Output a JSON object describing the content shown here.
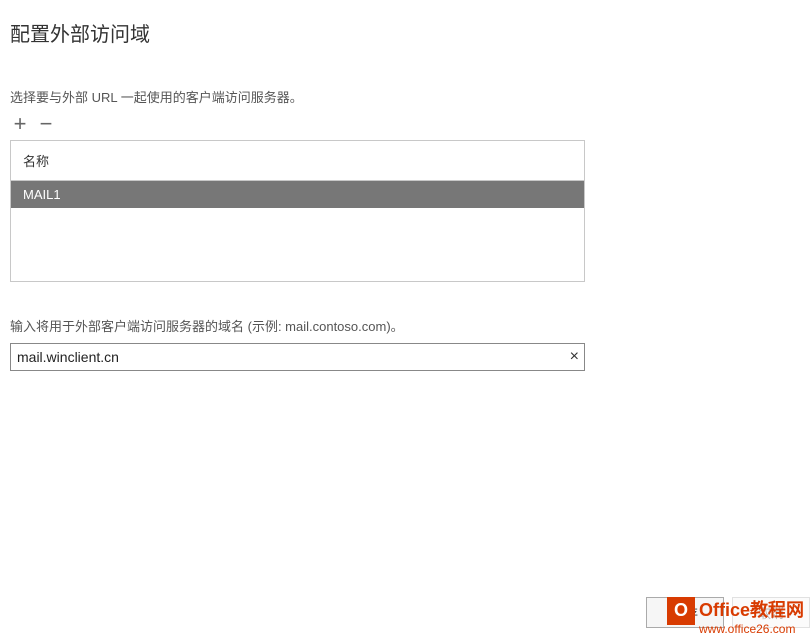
{
  "page": {
    "title": "配置外部访问域"
  },
  "section1": {
    "description": "选择要与外部 URL 一起使用的客户端访问服务器。",
    "toolbar": {
      "add": "+",
      "remove": "−"
    },
    "table": {
      "header": "名称",
      "rows": [
        {
          "name": "MAIL1"
        }
      ]
    }
  },
  "section2": {
    "description": "输入将用于外部客户端访问服务器的域名 (示例: mail.contoso.com)。",
    "input": {
      "value": "mail.winclient.cn",
      "clear": "×"
    }
  },
  "footer": {
    "save": "保存",
    "cancel": "取消"
  },
  "watermark": {
    "brand": "Office教程网",
    "url": "www.office26.com",
    "logo_letter": "O"
  }
}
